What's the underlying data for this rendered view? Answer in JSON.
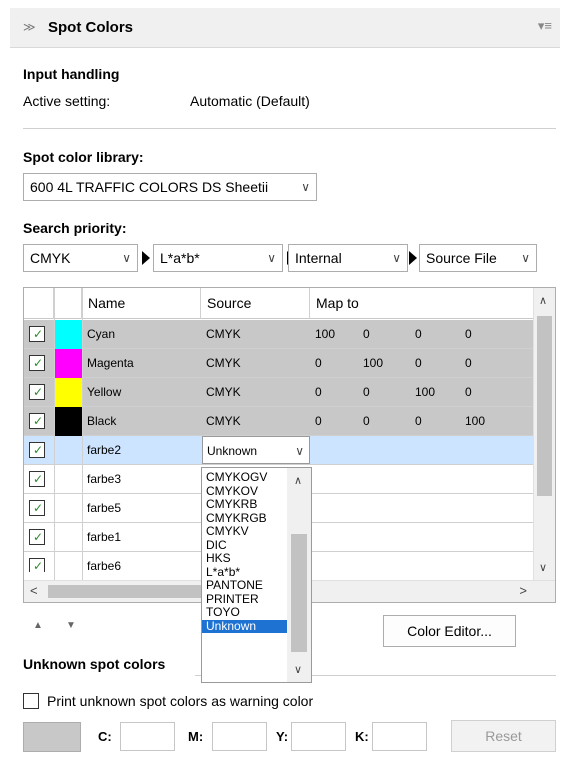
{
  "panel": {
    "title": "Spot Colors",
    "collapse_icon": "chevrons-up-icon",
    "menu_icon": "panel-menu-icon"
  },
  "input_handling": {
    "heading": "Input handling",
    "label": "Active setting:",
    "value": "Automatic (Default)"
  },
  "library": {
    "heading": "Spot color library:",
    "selected": "600 4L TRAFFIC COLORS DS Sheetii"
  },
  "search_priority": {
    "heading": "Search priority:",
    "items": [
      "CMYK",
      "L*a*b*",
      "Internal",
      "Source File"
    ]
  },
  "table": {
    "columns": [
      "Name",
      "Source",
      "Map to"
    ],
    "rows": [
      {
        "name": "Cyan",
        "swatch": "#00ffff",
        "source": "CMYK",
        "map": [
          "100",
          "0",
          "0",
          "0"
        ],
        "checked": true
      },
      {
        "name": "Magenta",
        "swatch": "#ff00ff",
        "source": "CMYK",
        "map": [
          "0",
          "100",
          "0",
          "0"
        ],
        "checked": true
      },
      {
        "name": "Yellow",
        "swatch": "#ffff00",
        "source": "CMYK",
        "map": [
          "0",
          "0",
          "100",
          "0"
        ],
        "checked": true
      },
      {
        "name": "Black",
        "swatch": "#000000",
        "source": "CMYK",
        "map": [
          "0",
          "0",
          "0",
          "100"
        ],
        "checked": true
      },
      {
        "name": "farbe2",
        "swatch": "",
        "source": "Unknown",
        "map": [],
        "checked": true
      },
      {
        "name": "farbe3",
        "swatch": "",
        "source": "",
        "map": [],
        "checked": true
      },
      {
        "name": "farbe5",
        "swatch": "",
        "source": "",
        "map": [],
        "checked": true
      },
      {
        "name": "farbe1",
        "swatch": "",
        "source": "",
        "map": [],
        "checked": true
      },
      {
        "name": "farbe6",
        "swatch": "",
        "source": "",
        "map": [],
        "checked": true
      }
    ]
  },
  "source_dropdown": {
    "options": [
      "CMYKOGV",
      "CMYKOV",
      "CMYKRB",
      "CMYKRGB",
      "CMYKV",
      "DIC",
      "HKS",
      "L*a*b*",
      "PANTONE",
      "PRINTER",
      "TOYO",
      "Unknown"
    ],
    "selected": "Unknown"
  },
  "color_editor_label": "Color Editor...",
  "unknown": {
    "heading": "Unknown spot colors",
    "checkbox_label": "Print unknown spot colors as warning color",
    "labels": [
      "C:",
      "M:",
      "Y:",
      "K:"
    ],
    "reset_label": "Reset"
  },
  "colors": {
    "selected_row": "#cce4ff",
    "gray_row": "#c8c8c8",
    "accent": "#1e73d2"
  }
}
